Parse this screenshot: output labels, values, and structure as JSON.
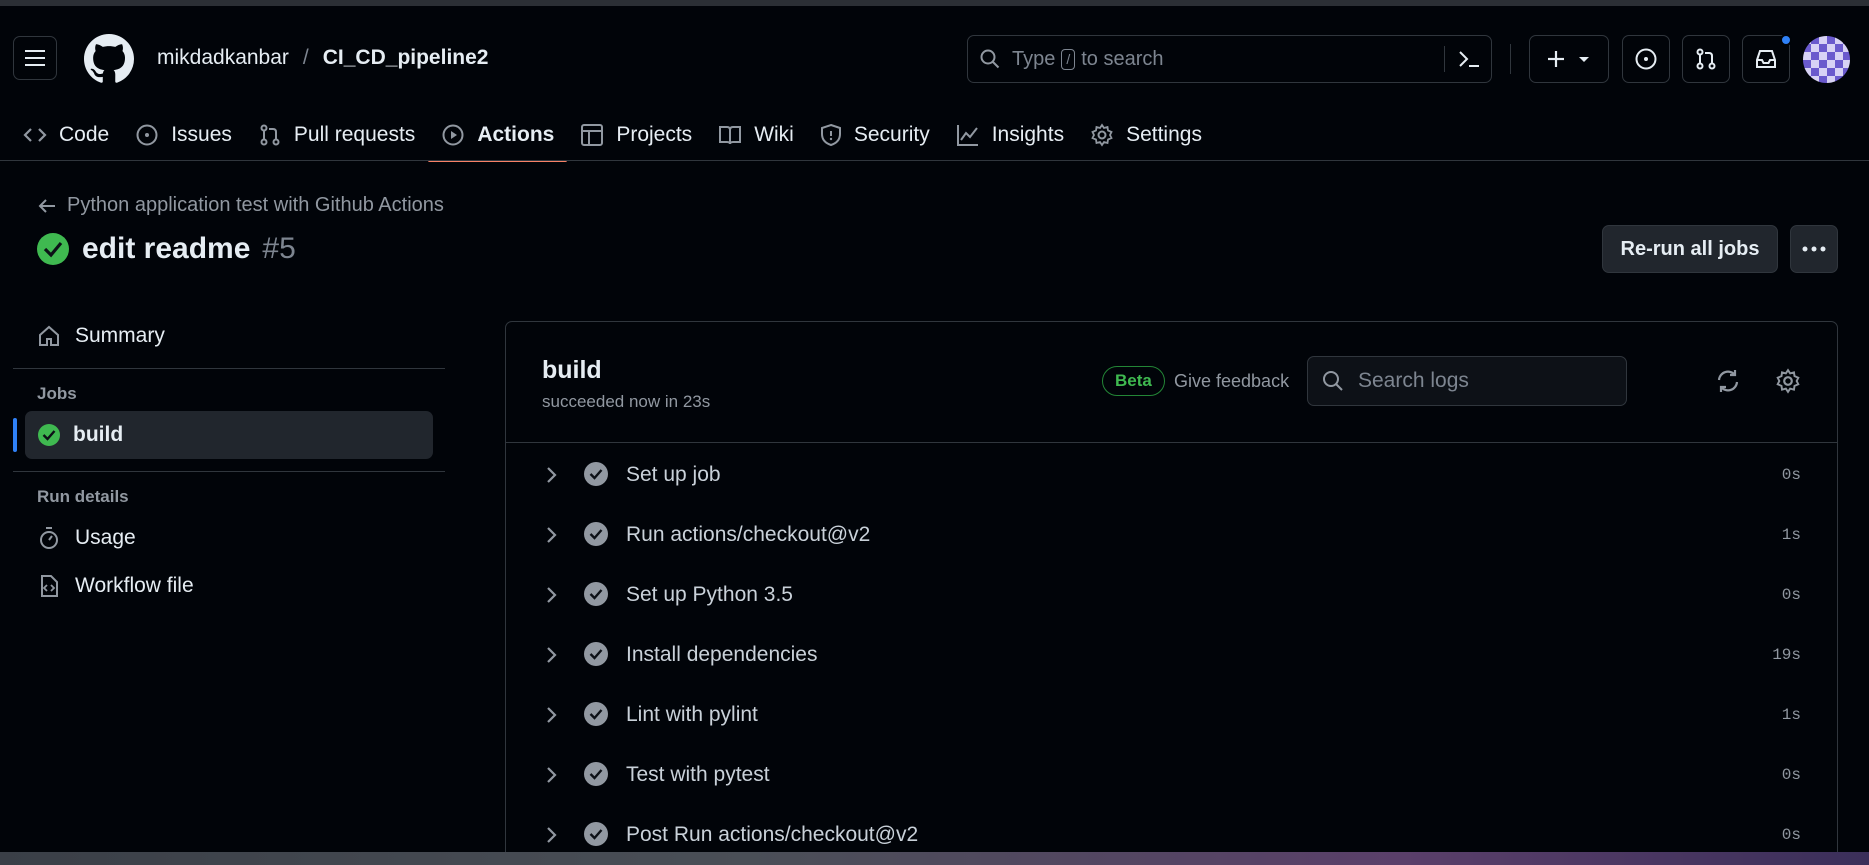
{
  "repo": {
    "owner": "mikdadkanbar",
    "separator": "/",
    "name": "CI_CD_pipeline2"
  },
  "search": {
    "placeholder_prefix": "Type",
    "key": "/",
    "placeholder_suffix": "to search"
  },
  "nav": {
    "tabs": [
      {
        "label": "Code",
        "icon": "code-icon"
      },
      {
        "label": "Issues",
        "icon": "issue-opened-icon"
      },
      {
        "label": "Pull requests",
        "icon": "git-pull-request-icon"
      },
      {
        "label": "Actions",
        "icon": "play-icon",
        "active": true
      },
      {
        "label": "Projects",
        "icon": "table-icon"
      },
      {
        "label": "Wiki",
        "icon": "book-icon"
      },
      {
        "label": "Security",
        "icon": "shield-icon"
      },
      {
        "label": "Insights",
        "icon": "graph-icon"
      },
      {
        "label": "Settings",
        "icon": "gear-icon"
      }
    ]
  },
  "run": {
    "workflow": "Python application test with Github Actions",
    "title": "edit readme",
    "number": "#5",
    "rerun_label": "Re-run all jobs"
  },
  "sidebar": {
    "summary": "Summary",
    "jobs_heading": "Jobs",
    "job": "build",
    "run_details_heading": "Run details",
    "usage": "Usage",
    "workflow_file": "Workflow file"
  },
  "job": {
    "name": "build",
    "status": "succeeded now in 23s",
    "beta": "Beta",
    "feedback": "Give feedback",
    "search_placeholder": "Search logs",
    "steps": [
      {
        "label": "Set up job",
        "duration": "0s"
      },
      {
        "label": "Run actions/checkout@v2",
        "duration": "1s"
      },
      {
        "label": "Set up Python 3.5",
        "duration": "0s"
      },
      {
        "label": "Install dependencies",
        "duration": "19s"
      },
      {
        "label": "Lint with pylint",
        "duration": "1s"
      },
      {
        "label": "Test with pytest",
        "duration": "0s"
      },
      {
        "label": "Post Run actions/checkout@v2",
        "duration": "0s"
      }
    ]
  },
  "colors": {
    "accent": "#f78166",
    "success": "#3fb950",
    "link": "#2f81f7"
  }
}
